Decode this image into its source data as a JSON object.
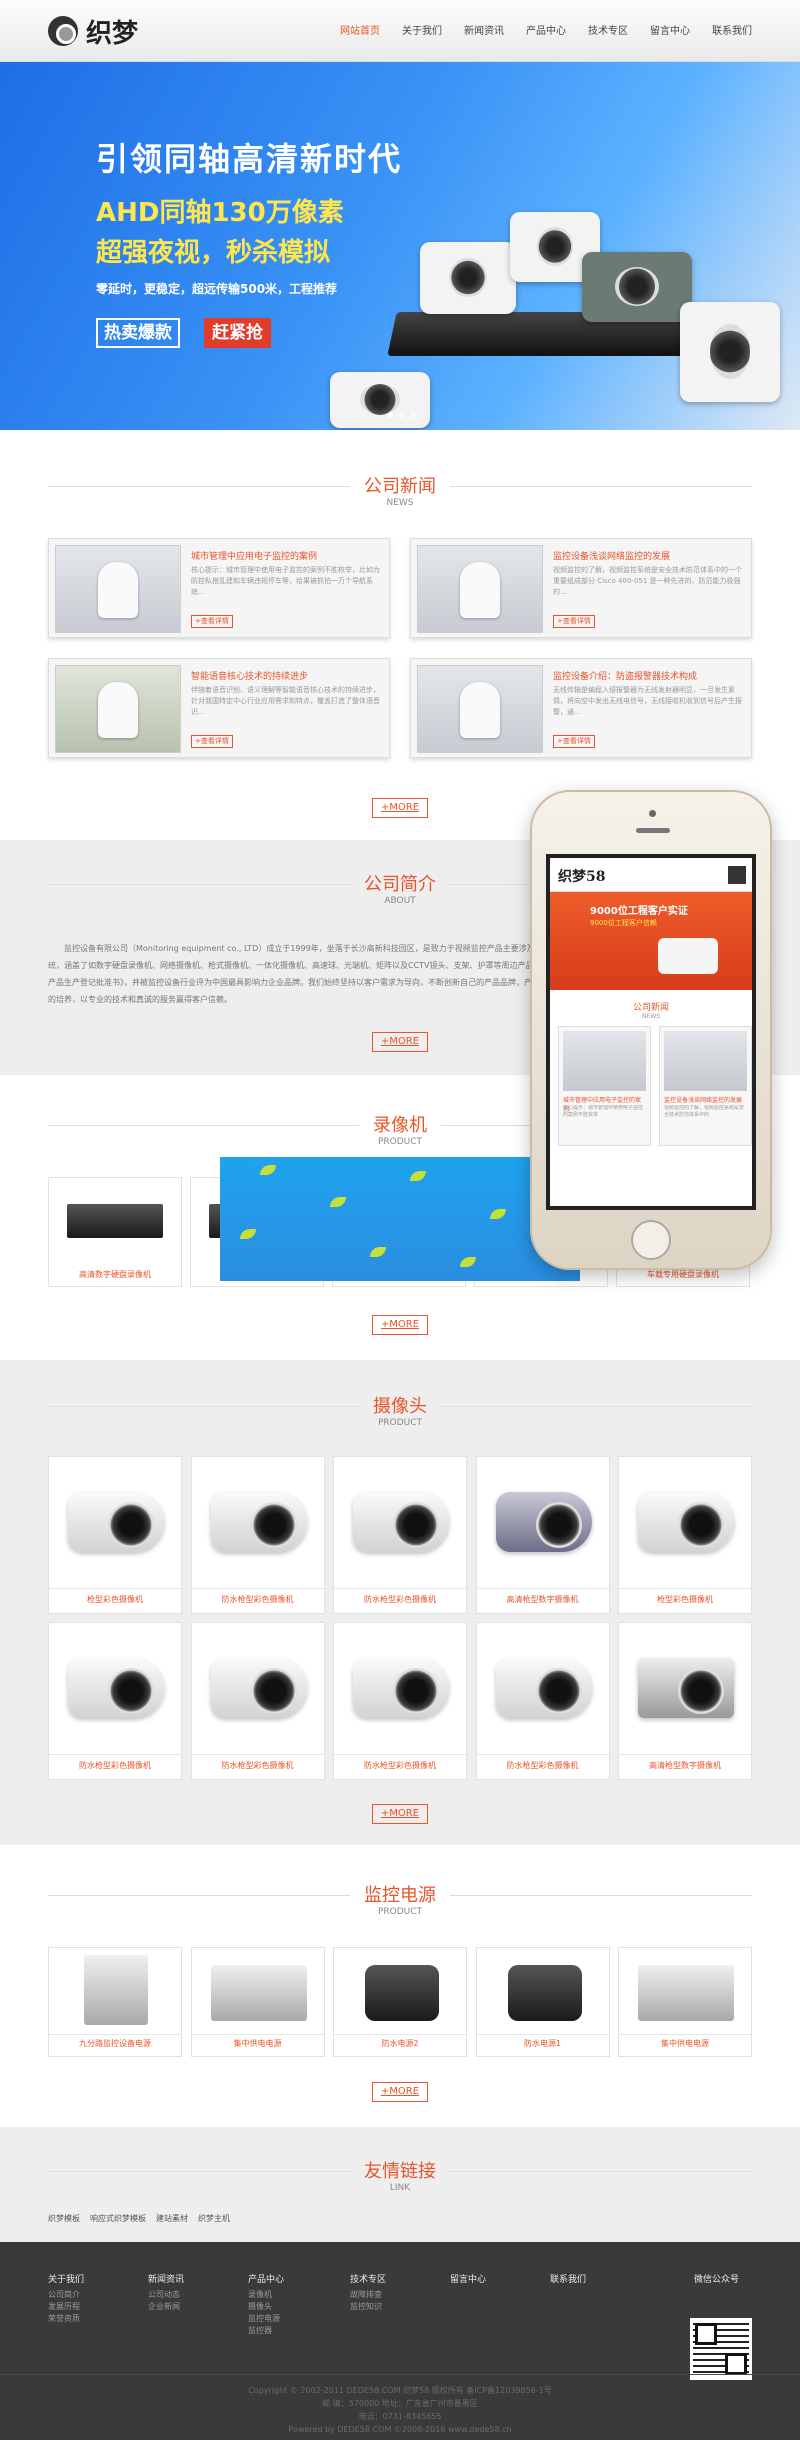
{
  "header": {
    "logo_text": "织梦",
    "nav": [
      {
        "label": "网站首页",
        "active": true
      },
      {
        "label": "关于我们"
      },
      {
        "label": "新闻资讯"
      },
      {
        "label": "产品中心"
      },
      {
        "label": "技术专区"
      },
      {
        "label": "留言中心"
      },
      {
        "label": "联系我们"
      }
    ]
  },
  "banner": {
    "title": "引领同轴高清新时代",
    "line1": "AHD同轴130万像素",
    "line2": "超强夜视，秒杀模拟",
    "line3": "零延时，更稳定，超远传输500米，工程推荐",
    "btn1": "热卖爆款",
    "btn2": "赶紧抢"
  },
  "news": {
    "title": "公司新闻",
    "subtitle": "NEWS",
    "more": "+MORE",
    "items": [
      {
        "title": "城市管理中应用电子监控的案例",
        "desc": "核心提示：城市管理中使用电子监控的案例不胜枚举，比如为防控私搭乱建和车辆违规停车等，给果被抓拍一万个导航系统...",
        "btn": "+查看详情"
      },
      {
        "title": "监控设备浅谈网络监控的发展",
        "desc": "视频监控的了解，视频监控系统是安全技术防范体系中的一个重要组成部分 Cisco 400-051 是一种先进的、防范能力极强的...",
        "btn": "+查看详情"
      },
      {
        "title": "智能语音核心技术的持续进步",
        "desc": "伴随着语音识别、语义理解等智能语音核心技术的持续进步，针对我国特定中心行业应用需求和特点，覆盖打造了整体语音识...",
        "btn": "+查看详情"
      },
      {
        "title": "监控设备介绍：防盗报警器技术构成",
        "desc": "无线传输是编程入侵报警器为无线发射器明显，一旦发生紧情，将向空中发出无线电信号，无线接收机收到信号后产生报警，通...",
        "btn": "+查看详情"
      }
    ]
  },
  "about": {
    "title": "公司简介",
    "subtitle": "ABOUT",
    "text": "监控设备有限公司（Monitoring equipment co., LTD）成立于1999年，坐落于长沙高新科技园区，是致力于视频监控产品主要涉及以数字视频压缩、互联网传输和云存储为核心的视频监控系统，涵盖了如数字硬盘录像机、网络摄像机、枪式摄像机、一体化摄像机、高速球、光端机、矩阵以及CCTV镜头、支架、护罩等周边产品，可满足不同项目对监控等不同类型和需求的《安全技术防范产品生产登记批准书》，并被监控设备行业评为中国最具影响力企业品牌。我们始终坚持以客户需求为导向，不断创新自己的产品品牌，产品性价比高。公司始终坚持以人为本，不断进取，注重对员工的培养，以专业的技术和真诚的服务赢得客户信赖。",
    "more": "+MORE"
  },
  "recorder": {
    "title": "录像机",
    "subtitle": "PRODUCT",
    "items": [
      {
        "caption": "高清数字硬盘录像机"
      },
      {
        "caption": ""
      },
      {
        "caption": ""
      },
      {
        "caption": ""
      },
      {
        "caption": "车载专用硬盘录像机"
      }
    ],
    "more": "+MORE"
  },
  "phone": {
    "logo": "织梦58",
    "banner_l1": "9000位工程客户实证",
    "banner_l2": "9000位工程客户信赖",
    "news_title": "公司新闻",
    "news_sub": "NEWS",
    "cards": [
      {
        "title": "城市管理中应用电子监控的案例",
        "desc": "核心提示：城市管理中使用电子监控的案例不胜枚举"
      },
      {
        "title": "监控设备浅谈网络监控的发展",
        "desc": "视频监控的了解，视频监控系统是安全技术防范体系中的"
      }
    ]
  },
  "camera": {
    "title": "摄像头",
    "subtitle": "PRODUCT",
    "items": [
      {
        "caption": "枪型彩色摄像机"
      },
      {
        "caption": "防水枪型彩色摄像机"
      },
      {
        "caption": "防水枪型彩色摄像机"
      },
      {
        "caption": "高清枪型数字摄像机"
      },
      {
        "caption": "枪型彩色摄像机"
      },
      {
        "caption": "防水枪型彩色摄像机"
      },
      {
        "caption": "防水枪型彩色摄像机"
      },
      {
        "caption": "防水枪型彩色摄像机"
      },
      {
        "caption": "防水枪型彩色摄像机"
      },
      {
        "caption": "高清枪型数字摄像机"
      }
    ],
    "more": "+MORE"
  },
  "power": {
    "title": "监控电源",
    "subtitle": "PRODUCT",
    "items": [
      {
        "caption": "九分路监控设备电源"
      },
      {
        "caption": "集中供电电源"
      },
      {
        "caption": "防水电源2"
      },
      {
        "caption": "防水电源1"
      },
      {
        "caption": "集中供电电源"
      }
    ],
    "more": "+MORE"
  },
  "links": {
    "title": "友情链接",
    "subtitle": "LINK",
    "items": [
      "织梦模板",
      "响应式织梦模板",
      "建站素材",
      "织梦主机"
    ]
  },
  "footer": {
    "cols": [
      {
        "title": "关于我们",
        "items": [
          "公司简介",
          "发展历程",
          "荣誉资质"
        ]
      },
      {
        "title": "新闻资讯",
        "items": [
          "公司动态",
          "企业新闻"
        ]
      },
      {
        "title": "产品中心",
        "items": [
          "录像机",
          "摄像头",
          "监控电源",
          "监控器"
        ]
      },
      {
        "title": "技术专区",
        "items": [
          "故障排查",
          "监控知识"
        ]
      },
      {
        "title": "留言中心",
        "items": []
      },
      {
        "title": "联系我们",
        "items": []
      },
      {
        "title": "微信公众号",
        "items": []
      }
    ],
    "copyright": "Copyright © 2002-2011 DEDE58.COM 织梦58 版权所有 备ICP备12039856-1号",
    "address": "邮 编：570000 地址：广东省广州市番禺区",
    "phone": "电话：0731-8345655",
    "powered": "Powered by DEDE58.COM ©2008-2016 www.dede58.cn"
  }
}
